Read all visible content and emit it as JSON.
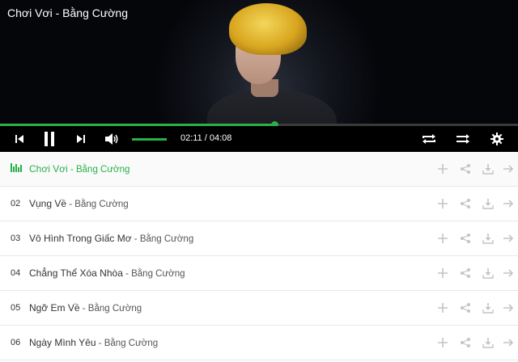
{
  "player": {
    "title_song": "Chơi Vơi",
    "title_sep": " - ",
    "title_artist": "Bằng Cường",
    "progress_fraction": 0.53,
    "volume_fraction": 1.0,
    "time_text": "02:11 / 04:08",
    "accent_color": "#28b04a",
    "icons": [
      "previous-icon",
      "pause-icon",
      "next-icon",
      "volume-icon",
      "repeat-icon",
      "shuffle-icon",
      "gear-icon"
    ]
  },
  "playlist": {
    "items": [
      {
        "num": "",
        "song": "Chơi Vơi",
        "sep": " - ",
        "artist": "Bằng Cường",
        "active": true
      },
      {
        "num": "02",
        "song": "Vụng Về",
        "sep": " - ",
        "artist": "Bằng Cường",
        "active": false
      },
      {
        "num": "03",
        "song": "Vô Hình Trong Giấc Mơ",
        "sep": " - ",
        "artist": "Bằng Cường",
        "active": false
      },
      {
        "num": "04",
        "song": "Chẳng Thể Xóa Nhòa",
        "sep": " - ",
        "artist": "Bằng Cường",
        "active": false
      },
      {
        "num": "05",
        "song": "Ngỡ Em Về",
        "sep": " - ",
        "artist": "Bằng Cường",
        "active": false
      },
      {
        "num": "06",
        "song": "Ngày Mình Yêu",
        "sep": " - ",
        "artist": "Bằng Cường",
        "active": false
      }
    ],
    "row_actions": [
      "add-icon",
      "share-icon",
      "download-icon",
      "arrow-right-icon"
    ]
  }
}
